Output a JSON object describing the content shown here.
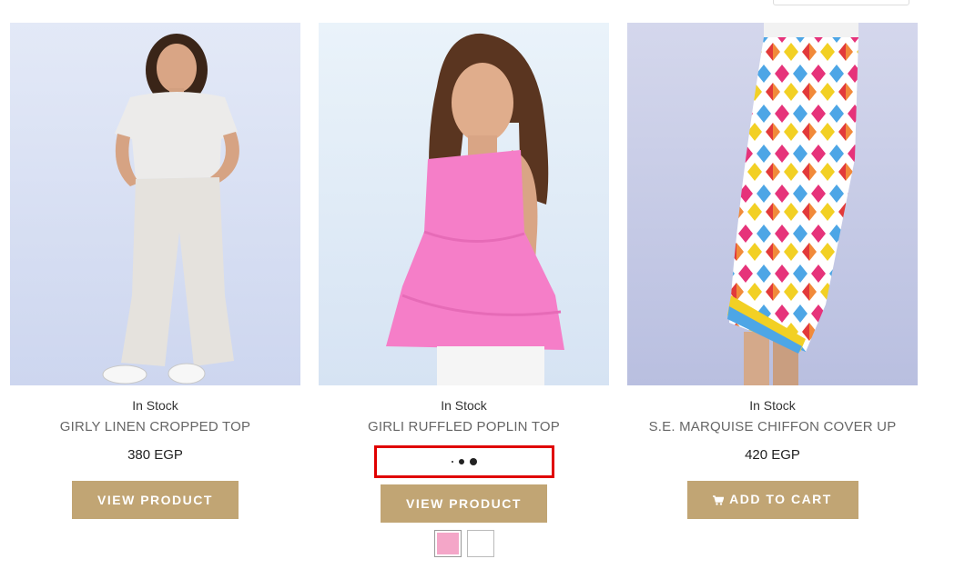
{
  "products": [
    {
      "stock": "In Stock",
      "title": "GIRLY LINEN CROPPED TOP",
      "price": "380 EGP",
      "button": "VIEW PRODUCT"
    },
    {
      "stock": "In Stock",
      "title": "GIRLI RUFFLED POPLIN TOP",
      "button": "VIEW PRODUCT",
      "swatches": [
        {
          "color": "#f4a6c8"
        },
        {
          "color": "#ffffff"
        }
      ]
    },
    {
      "stock": "In Stock",
      "title": "S.E. MARQUISE CHIFFON COVER UP",
      "price": "420 EGP",
      "button": "ADD TO CART",
      "button_icon": "cart-icon"
    }
  ],
  "colors": {
    "button_bg": "#c1a574",
    "highlight": "#e00000"
  }
}
